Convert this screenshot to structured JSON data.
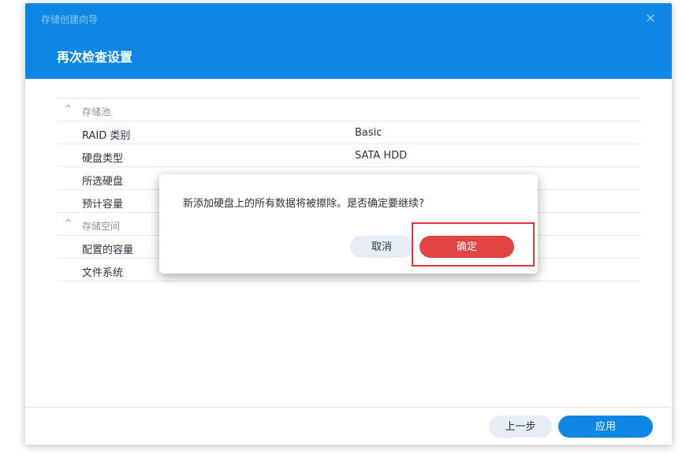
{
  "wizard": {
    "window_title": "存储创建向导",
    "close_icon": "×",
    "heading": "再次检查设置"
  },
  "summary": {
    "section1": {
      "title": "存储池",
      "chevron": "^"
    },
    "rows1": [
      {
        "label": "RAID 类别",
        "value": "Basic"
      },
      {
        "label": "硬盘类型",
        "value": "SATA HDD"
      },
      {
        "label": "所选硬盘",
        "value": ""
      },
      {
        "label": "预计容量",
        "value": ""
      }
    ],
    "section2": {
      "title": "存储空间",
      "chevron": "^"
    },
    "rows2": [
      {
        "label": "配置的容量",
        "value": ""
      },
      {
        "label": "文件系统",
        "value": ""
      }
    ]
  },
  "footer": {
    "prev_label": "上一步",
    "apply_label": "应用"
  },
  "dialog": {
    "message": "新添加硬盘上的所有数据将被擦除。是否确定要继续?",
    "cancel_label": "取消",
    "confirm_label": "确定"
  },
  "colors": {
    "header": "#0e86e4",
    "confirm": "#e24343",
    "highlight": "#e5343a"
  }
}
